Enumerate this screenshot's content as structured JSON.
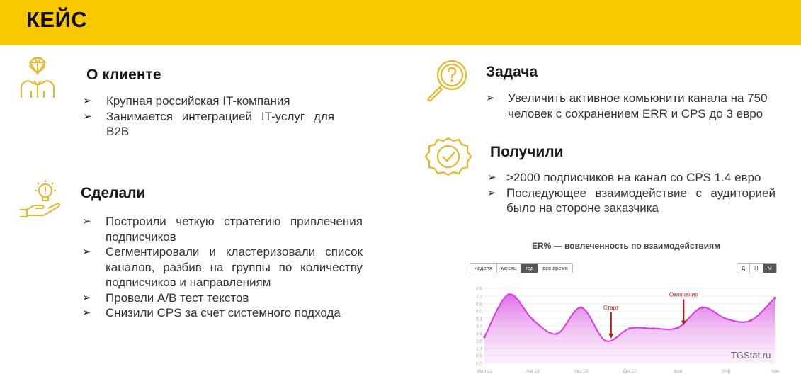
{
  "header": {
    "title": "КЕЙС"
  },
  "client": {
    "title": "О клиенте",
    "items": [
      "Крупная российская IT-компания",
      "Занимается интеграцией IT-услуг для B2B"
    ]
  },
  "done": {
    "title": "Сделали",
    "items": [
      "Построили четкую стратегию привлечения подписчиков",
      "Сегментировали и кластеризовали список каналов, разбив на группы по количеству подписчиков и направлениям",
      "Провели A/B тест текстов",
      "Снизили CPS за счет системного подхода"
    ]
  },
  "task": {
    "title": "Задача",
    "items": [
      "Увеличить активное комьюнити канала на 750 человек с сохранением ERR и CPS до 3 евро"
    ]
  },
  "result": {
    "title": "Получили",
    "items": [
      ">2000 подписчиков на канал со CPS 1.4 евро",
      "Последующее взаимодействие с аудиторией было на стороне заказчика"
    ]
  },
  "bullet_symbol": "➢",
  "chart_controls": {
    "periods": [
      "неделя",
      "месяц",
      "год",
      "все время"
    ],
    "active_period": "год",
    "granularity": [
      "Д",
      "Н",
      "М"
    ],
    "active_granularity": "М"
  },
  "watermark": "TGStat.ru",
  "colors": {
    "header": "#f9c800",
    "icon": "#e8b62a",
    "line": "#d63de0",
    "annotation": "#b01c1c"
  },
  "chart_data": {
    "type": "area",
    "title": "ER% — вовлеченность по взаимодействиям",
    "x_ticks": [
      "Июн'23",
      "Авг'23",
      "Окт'23",
      "Дек'23",
      "Фев",
      "Апр",
      "Июн"
    ],
    "x": [
      "Июн'23",
      "Июл'23",
      "Авг'23",
      "Сен'23",
      "Окт'23",
      "Ноя'23",
      "Дек'23",
      "Янв",
      "Фев",
      "Мар",
      "Апр",
      "Май",
      "Июн"
    ],
    "y_ticks": [
      0.0,
      0.9,
      1.7,
      2.6,
      3.4,
      4.3,
      5.1,
      6.0,
      6.8,
      7.7,
      8.6
    ],
    "ylim": [
      0,
      8.6
    ],
    "values": [
      3.0,
      7.9,
      5.0,
      3.4,
      6.4,
      2.6,
      4.0,
      4.0,
      4.1,
      6.4,
      5.1,
      4.9,
      7.5
    ],
    "annotations": [
      {
        "label": "Старт",
        "x": "Ноя'23"
      },
      {
        "label": "Окончание",
        "x": "Фев"
      }
    ]
  }
}
